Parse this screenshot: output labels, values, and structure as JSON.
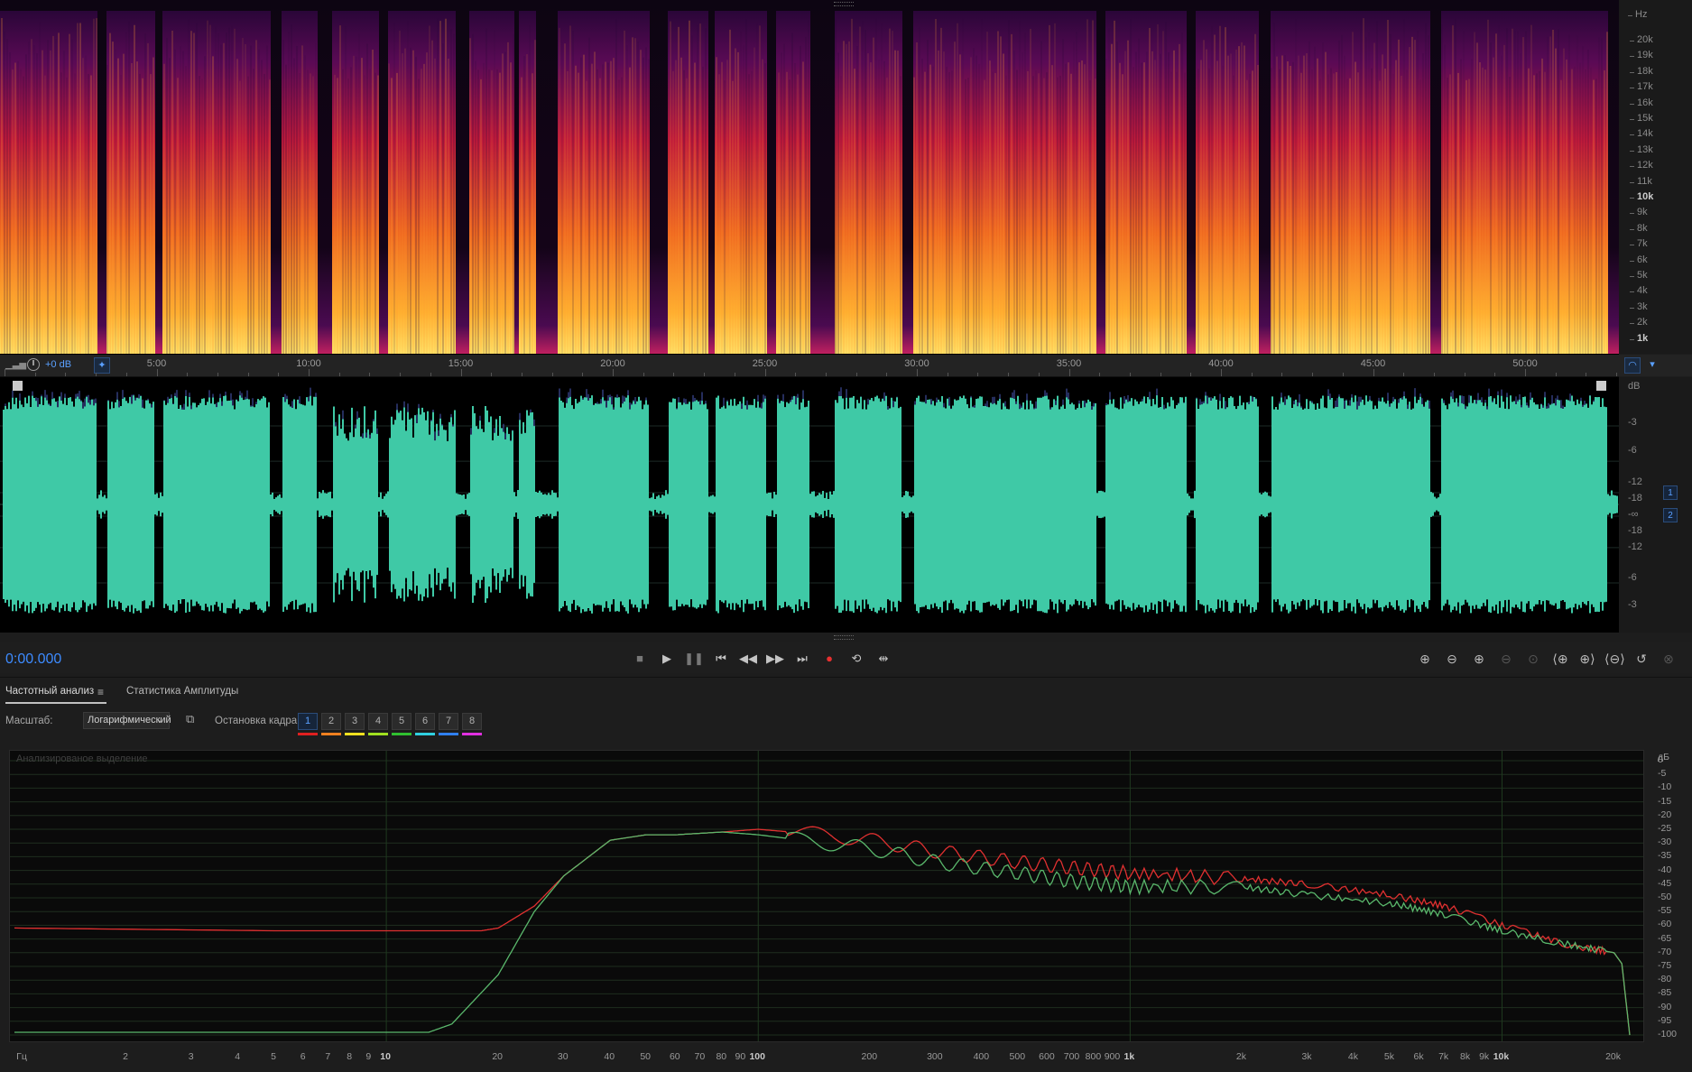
{
  "spectral_display": {
    "unit": "Hz",
    "ticks": [
      "20k",
      "19k",
      "18k",
      "17k",
      "16k",
      "15k",
      "14k",
      "13k",
      "12k",
      "11k",
      "10k",
      "9k",
      "8k",
      "7k",
      "6k",
      "5k",
      "4k",
      "3k",
      "2k",
      "1k"
    ]
  },
  "timeline": {
    "gain": "+0 dB",
    "labels": [
      "5:00",
      "10:00",
      "15:00",
      "20:00",
      "25:00",
      "30:00",
      "35:00",
      "40:00",
      "45:00",
      "50:00"
    ]
  },
  "waveform": {
    "unit": "dB",
    "ticks": [
      "-3",
      "-6",
      "-12",
      "-18",
      "-∞",
      "-18",
      "-12",
      "-6",
      "-3"
    ],
    "channels": [
      "1",
      "2"
    ],
    "colors": {
      "wave": "#3fc9a6",
      "peaks": "#4a5ab8"
    }
  },
  "transport": {
    "timecode": "0:00.000",
    "icons": [
      "stop-icon",
      "play-icon",
      "pause-icon",
      "skip-start-icon",
      "rewind-icon",
      "fast-forward-icon",
      "skip-end-icon",
      "record-icon",
      "loop-icon",
      "skip-selection-icon"
    ],
    "zoom_icons": [
      "zoom-in-amplitude-icon",
      "zoom-out-amplitude-icon",
      "zoom-in-time-icon",
      "zoom-out-time-icon",
      "zoom-selection-icon",
      "zoom-in-left-icon",
      "zoom-in-right-icon",
      "zoom-out-full-icon",
      "zoom-reset-icon",
      "zoom-spectral-icon"
    ]
  },
  "panel": {
    "tabs": [
      "Частотный анализ",
      "Статистика Амплитуды"
    ],
    "scale_label": "Масштаб:",
    "scale_value": "Логарифмический",
    "frame_label": "Остановка кадра:",
    "frames": [
      "1",
      "2",
      "3",
      "4",
      "5",
      "6",
      "7",
      "8"
    ],
    "frame_colors": [
      "#e02020",
      "#f08020",
      "#f0e020",
      "#a0e020",
      "#30c030",
      "#30d0e0",
      "#3080f0",
      "#e030e0"
    ],
    "plot_label": "Анализированое выделение"
  },
  "chart_data": {
    "type": "line",
    "title": "Анализированое выделение",
    "xlabel": "Гц",
    "ylabel": "дБ",
    "x_scale": "log",
    "xlim": [
      1,
      22050
    ],
    "ylim": [
      -100,
      0
    ],
    "x_tick_labels": [
      "Гц",
      "2",
      "3",
      "4",
      "5",
      "6",
      "7",
      "8",
      "9",
      "10",
      "20",
      "30",
      "40",
      "50",
      "60",
      "70",
      "80",
      "90",
      "100",
      "200",
      "300",
      "400",
      "500",
      "600",
      "700",
      "800",
      "900",
      "1k",
      "2k",
      "3k",
      "4k",
      "5k",
      "6k",
      "7k",
      "8k",
      "9k",
      "10k",
      "20k"
    ],
    "y_tick_labels": [
      "дБ",
      "0",
      "-5",
      "-10",
      "-15",
      "-20",
      "-25",
      "-30",
      "-35",
      "-40",
      "-45",
      "-50",
      "-55",
      "-60",
      "-65",
      "-70",
      "-75",
      "-80",
      "-85",
      "-90",
      "-95",
      "-100"
    ],
    "grid": true,
    "series": [
      {
        "channel": 1,
        "color": "#e03030",
        "x": [
          1,
          5,
          10,
          15,
          18,
          20,
          25,
          30,
          40,
          50,
          60,
          80,
          100,
          150,
          200,
          300,
          500,
          700,
          1000,
          2000,
          3000,
          5000,
          7000,
          10000,
          15000,
          20000,
          21000,
          22050
        ],
        "y": [
          -61,
          -62,
          -62,
          -62,
          -62,
          -61,
          -53,
          -42,
          -29,
          -27,
          -27,
          -26,
          -25,
          -27,
          -29,
          -33,
          -37,
          -39,
          -41,
          -43,
          -45,
          -49,
          -53,
          -60,
          -67,
          -70,
          -74,
          -100
        ]
      },
      {
        "channel": 2,
        "color": "#5ab86c",
        "x": [
          1,
          5,
          10,
          13,
          15,
          20,
          25,
          30,
          40,
          50,
          60,
          80,
          100,
          150,
          200,
          300,
          500,
          700,
          1000,
          2000,
          3000,
          5000,
          7000,
          10000,
          15000,
          20000,
          21000,
          22050
        ],
        "y": [
          -99,
          -99,
          -99,
          -99,
          -96,
          -78,
          -55,
          -42,
          -29,
          -27,
          -27,
          -26,
          -27,
          -30,
          -32,
          -37,
          -41,
          -44,
          -46,
          -46,
          -49,
          -52,
          -56,
          -62,
          -67,
          -70,
          -74,
          -100
        ]
      }
    ]
  }
}
